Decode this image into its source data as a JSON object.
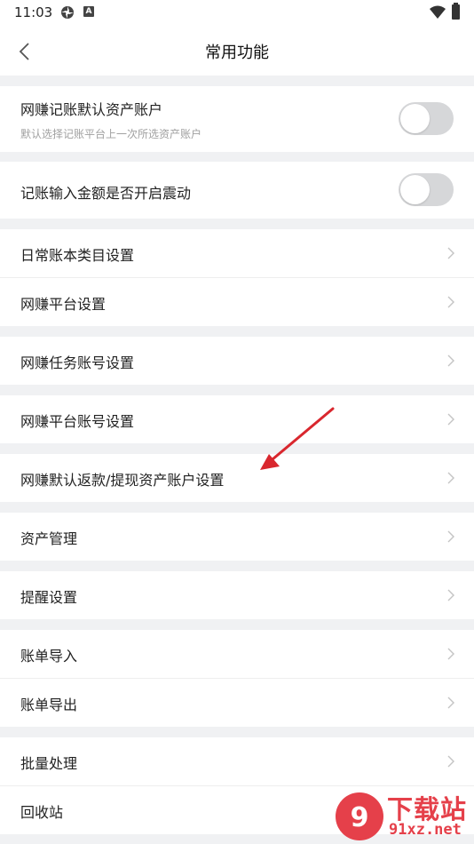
{
  "status_bar": {
    "time": "11:03",
    "icon_badge": "A"
  },
  "header": {
    "title": "常用功能"
  },
  "groups": [
    {
      "items": [
        {
          "label": "网赚记账默认资产账户",
          "sublabel": "默认选择记账平台上一次所选资产账户",
          "type": "toggle",
          "on": false
        }
      ]
    },
    {
      "items": [
        {
          "label": "记账输入金额是否开启震动",
          "type": "toggle",
          "on": false
        }
      ]
    },
    {
      "items": [
        {
          "label": "日常账本类目设置"
        },
        {
          "label": "网赚平台设置"
        }
      ]
    },
    {
      "items": [
        {
          "label": "网赚任务账号设置"
        }
      ]
    },
    {
      "items": [
        {
          "label": "网赚平台账号设置"
        }
      ]
    },
    {
      "items": [
        {
          "label": "网赚默认返款/提现资产账户设置"
        }
      ]
    },
    {
      "items": [
        {
          "label": "资产管理"
        }
      ]
    },
    {
      "items": [
        {
          "label": "提醒设置"
        }
      ]
    },
    {
      "items": [
        {
          "label": "账单导入"
        },
        {
          "label": "账单导出"
        }
      ]
    },
    {
      "items": [
        {
          "label": "批量处理"
        },
        {
          "label": "回收站"
        }
      ]
    }
  ],
  "watermark": {
    "title": "下载站",
    "url": "91xz.net"
  },
  "colors": {
    "accent_red": "#e5404a",
    "toggle_off": "#d6d7d9",
    "background": "#f0f1f3"
  }
}
